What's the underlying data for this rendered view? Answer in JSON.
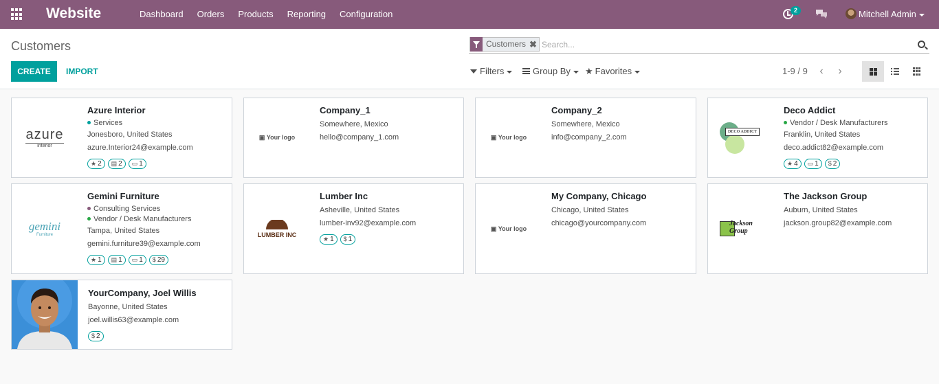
{
  "navbar": {
    "app_name": "Website",
    "menu": [
      "Dashboard",
      "Orders",
      "Products",
      "Reporting",
      "Configuration"
    ],
    "activity_count": "2",
    "user_name": "Mitchell Admin",
    "color": "#875a7b"
  },
  "control_panel": {
    "breadcrumb": "Customers",
    "create_label": "CREATE",
    "import_label": "IMPORT",
    "search": {
      "facet": "Customers",
      "facet_remove": "✖",
      "placeholder": "Search..."
    },
    "filters_label": "Filters",
    "groupby_label": "Group By",
    "favorites_label": "Favorites",
    "pager": "1-9 / 9",
    "accent": "#00a09d"
  },
  "cards": [
    {
      "name": "Azure Interior",
      "logo_text": "azure",
      "logo_sub": "interior",
      "tags": [
        {
          "label": "Services",
          "color": "#00a09d"
        }
      ],
      "location": "Jonesboro, United States",
      "email": "azure.Interior24@example.com",
      "badges": [
        {
          "icon": "star",
          "glyph": "★",
          "value": "2"
        },
        {
          "icon": "calendar",
          "glyph": "▤",
          "value": "2"
        },
        {
          "icon": "cart",
          "glyph": "▭",
          "value": "1"
        }
      ]
    },
    {
      "name": "Company_1",
      "logo_text": "Your logo",
      "tags": [],
      "location": "Somewhere, Mexico",
      "email": "hello@company_1.com",
      "badges": []
    },
    {
      "name": "Company_2",
      "logo_text": "Your logo",
      "tags": [],
      "location": "Somewhere, Mexico",
      "email": "info@company_2.com",
      "badges": []
    },
    {
      "name": "Deco Addict",
      "logo_text": "DECO ADDICT",
      "tags": [
        {
          "label": "Vendor / Desk Manufacturers",
          "color": "#28a745"
        }
      ],
      "location": "Franklin, United States",
      "email": "deco.addict82@example.com",
      "badges": [
        {
          "icon": "star",
          "glyph": "★",
          "value": "4"
        },
        {
          "icon": "cart",
          "glyph": "▭",
          "value": "1"
        },
        {
          "icon": "dollar",
          "glyph": "$",
          "value": "2"
        }
      ]
    },
    {
      "name": "Gemini Furniture",
      "logo_text": "gemini",
      "logo_sub": "Furniture",
      "tags": [
        {
          "label": "Consulting Services",
          "color": "#875a7b"
        },
        {
          "label": "Vendor / Desk Manufacturers",
          "color": "#28a745"
        }
      ],
      "location": "Tampa, United States",
      "email": "gemini.furniture39@example.com",
      "badges": [
        {
          "icon": "star",
          "glyph": "★",
          "value": "1"
        },
        {
          "icon": "calendar",
          "glyph": "▤",
          "value": "1"
        },
        {
          "icon": "cart",
          "glyph": "▭",
          "value": "1"
        },
        {
          "icon": "dollar",
          "glyph": "$",
          "value": "29"
        }
      ]
    },
    {
      "name": "Lumber Inc",
      "logo_text": "LUMBER INC",
      "tags": [],
      "location": "Asheville, United States",
      "email": "lumber-inv92@example.com",
      "badges": [
        {
          "icon": "star",
          "glyph": "★",
          "value": "1"
        },
        {
          "icon": "dollar",
          "glyph": "$",
          "value": "1"
        }
      ]
    },
    {
      "name": "My Company, Chicago",
      "logo_text": "Your logo",
      "tags": [],
      "location": "Chicago, United States",
      "email": "chicago@yourcompany.com",
      "badges": []
    },
    {
      "name": "The Jackson Group",
      "logo_text": "Jackson Group",
      "tags": [],
      "location": "Auburn, United States",
      "email": "jackson.group82@example.com",
      "badges": []
    },
    {
      "name": "YourCompany, Joel Willis",
      "tags": [],
      "location": "Bayonne, United States",
      "email": "joel.willis63@example.com",
      "badges": [
        {
          "icon": "dollar",
          "glyph": "$",
          "value": "2"
        }
      ]
    }
  ]
}
